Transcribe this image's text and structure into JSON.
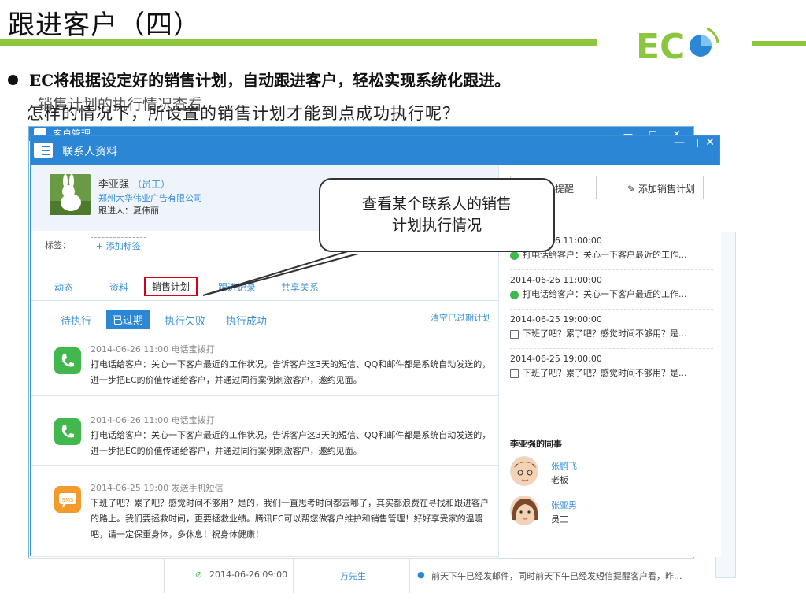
{
  "slide": {
    "title": "跟进客户（四）",
    "bullet": "EC将根据设定好的销售计划，自动跟进客户，轻松实现系统化跟进。",
    "line_a": "销售计划的执行情况查看",
    "line_b": "怎样的情况下，所设置的销售计划才能到点成功执行呢？"
  },
  "logo": {
    "text": "EC"
  },
  "back_window": {
    "title": "客户管理",
    "bottom_row": {
      "time": "2014-06-26 09:00",
      "name": "万先生",
      "note": "前天下午已经发邮件，同时前天下午已经发短信提醒客户看，昨..."
    }
  },
  "window": {
    "title": "联系人资料",
    "controls": [
      "—",
      "□",
      "✕"
    ]
  },
  "profile": {
    "name": "李亚强",
    "role": "（员工）",
    "company": "郑州大华伟业广告有限公司",
    "follower": "跟进人：夏伟丽",
    "tags_label": "标签：",
    "add_tag": "+ 添加标签"
  },
  "tabs": [
    "动态",
    "资料",
    "销售计划",
    "跟进记录",
    "共享关系"
  ],
  "subtabs": [
    "待执行",
    "已过期",
    "执行失败",
    "执行成功"
  ],
  "clear_link": "清空已过期计划",
  "entries": [
    {
      "head": "2014-06-26 11:00  电话宝拨打",
      "text": "打电话给客户：关心一下客户最近的工作状况，告诉客户这3天的短信、QQ和邮件都是系统自动发送的，进一步把EC的价值传递给客户，并通过同行案例刺激客户，邀约见面。"
    },
    {
      "head": "2014-06-26 11:00  电话宝拨打",
      "text": "打电话给客户：关心一下客户最近的工作状况，告诉客户这3天的短信、QQ和邮件都是系统自动发送的，进一步把EC的价值传递给客户，并通过同行案例刺激客户，邀约见面。"
    },
    {
      "head": "2014-06-25 19:00  发送手机短信",
      "text": "下班了吧？累了吧？感觉时间不够用？是的，我们一直思考时间都去哪了，其实都浪费在寻找和跟进客户的路上。我们要拯救时间，更要拯救业绩。腾讯EC可以帮您做客户维护和销售管理！好好享受家的温暖吧，请一定保重身体，多休息！祝身体健康！"
    }
  ],
  "right": {
    "btn_reminder": "提醒",
    "btn_add_plan": "添加销售计划",
    "items": [
      {
        "time": "2014-06-26 11:00:00",
        "desc": "打电话给客户：关心一下客户最近的工作...",
        "icon": "phone-icon"
      },
      {
        "time": "2014-06-26 11:00:00",
        "desc": "打电话给客户：关心一下客户最近的工作...",
        "icon": "phone-icon"
      },
      {
        "time": "2014-06-25 19:00:00",
        "desc": "下班了吧？累了吧？感觉时间不够用？是...",
        "icon": "message-icon"
      },
      {
        "time": "2014-06-25 19:00:00",
        "desc": "下班了吧？累了吧？感觉时间不够用？是...",
        "icon": "message-icon"
      }
    ],
    "colleagues_title": "李亚强的同事",
    "colleagues": [
      {
        "name": "张鹏飞",
        "role": "老板"
      },
      {
        "name": "张亚男",
        "role": "员工"
      }
    ]
  },
  "callout": {
    "line1": "查看某个联系人的销售",
    "line2": "计划执行情况"
  },
  "colors": {
    "brand_blue": "#2b86d6",
    "accent_green": "#8cc63f",
    "highlight_red": "#d0021b"
  }
}
